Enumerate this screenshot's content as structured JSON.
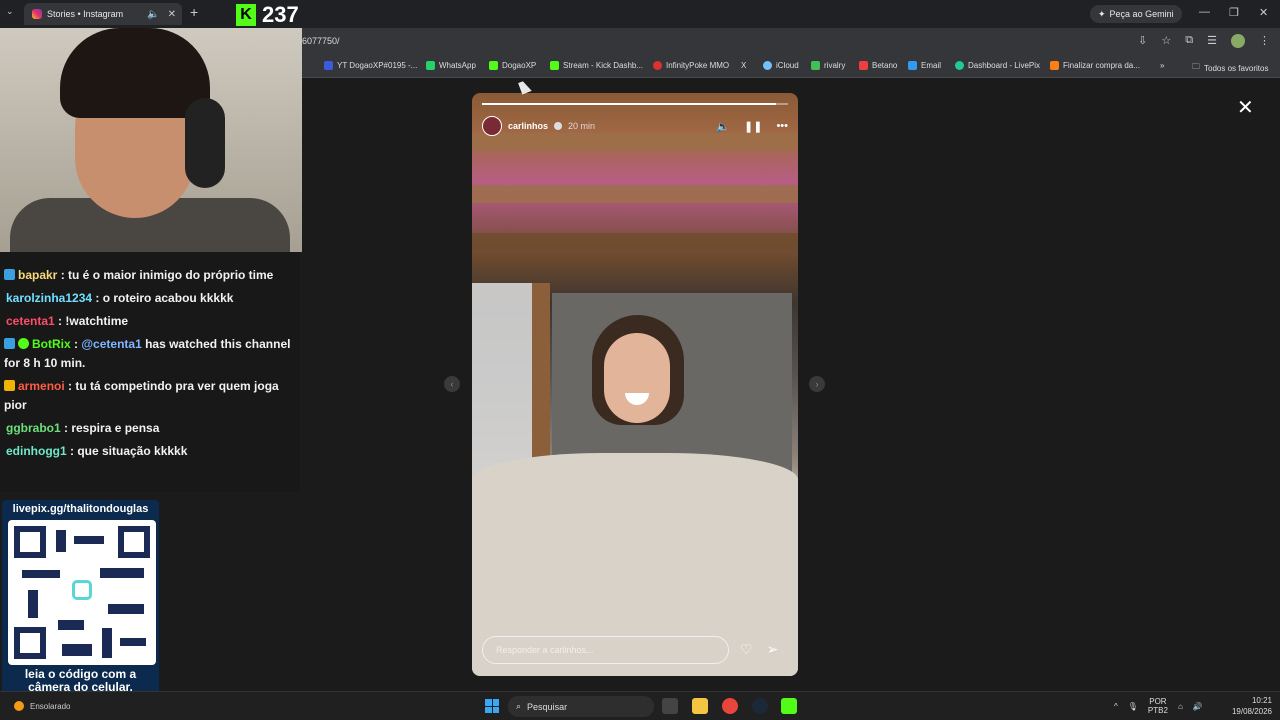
{
  "browser": {
    "tab_title": "Stories • Instagram",
    "url": "6077750/",
    "gemini_label": "Peça ao Gemini",
    "bookmarks": [
      {
        "label": "YT DogaoXP#0195 -...",
        "color": "#3b5bdb"
      },
      {
        "label": "WhatsApp",
        "color": "#25d366"
      },
      {
        "label": "DogaoXP",
        "color": "#53fc18"
      },
      {
        "label": "Stream - Kick Dashb...",
        "color": "#53fc18"
      },
      {
        "label": "InfinityPoke MMO",
        "color": "#e03131"
      },
      {
        "label": "X",
        "color": "#ffffff"
      },
      {
        "label": "iCloud",
        "color": "#74c0fc"
      },
      {
        "label": "rivalry",
        "color": "#40c057"
      },
      {
        "label": "Betano",
        "color": "#f03e3e"
      },
      {
        "label": "Email",
        "color": "#339af0"
      },
      {
        "label": "Dashboard - LivePix",
        "color": "#20c997"
      },
      {
        "label": "Finalizar compra da...",
        "color": "#fd7e14"
      }
    ],
    "all_bookmarks": "Todos os favoritos"
  },
  "stream": {
    "viewer_count": "237",
    "chat": [
      {
        "user": "bapakr",
        "user_color": "#f7d87a",
        "text": " : tu é o maior inimigo do próprio time",
        "badge": "#3aa0e0"
      },
      {
        "user": "karolzinha1234",
        "user_color": "#6fe0ff",
        "text": " : o roteiro acabou kkkkk",
        "badge": ""
      },
      {
        "user": "cetenta1",
        "user_color": "#ff4d6a",
        "text": " : !watchtime",
        "badge": ""
      },
      {
        "user": "BotRix",
        "user_color": "#53fc18",
        "text": " : @cetenta1 has watched this channel for 8 h 10 min.",
        "badge": "#3aa0e0",
        "mention": "@cetenta1"
      },
      {
        "user": "armenoi",
        "user_color": "#ff5b45",
        "text": " : tu tá competindo pra ver quem joga pior",
        "badge": "#f0b400"
      },
      {
        "user": "ggbrabo1",
        "user_color": "#6be07a",
        "text": " : respira e pensa",
        "badge": ""
      },
      {
        "user": "edinhogg1",
        "user_color": "#6fe8c8",
        "text": " : que situação kkkkk",
        "badge": ""
      }
    ],
    "qr_top": "livepix.gg/thalitondouglas",
    "qr_bottom_1": "leia o código com a",
    "qr_bottom_2": "câmera do celular."
  },
  "story": {
    "username": "carlinhos",
    "time": "20 min",
    "progress": 0.96,
    "reply_placeholder": "Responder a carlinhos..."
  },
  "taskbar": {
    "weather": "Ensolarado",
    "search_placeholder": "Pesquisar",
    "lang_1": "POR",
    "lang_2": "PTB2",
    "time": "10:21",
    "date": "19/08/2026"
  }
}
